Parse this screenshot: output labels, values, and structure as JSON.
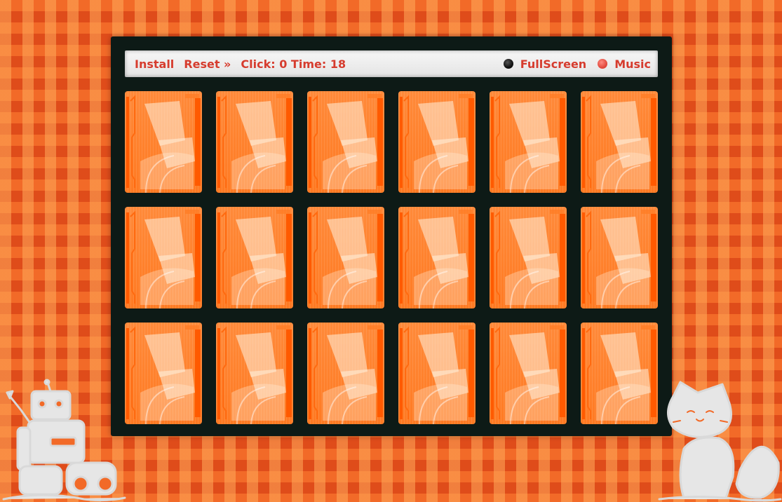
{
  "toolbar": {
    "install_label": "Install",
    "reset_label": "Reset »",
    "click_label": "Click:",
    "click_count": "0",
    "time_label": "Time:",
    "time_value": "18",
    "fullscreen_label": "FullScreen",
    "music_label": "Music"
  },
  "board": {
    "rows": 3,
    "columns": 6,
    "cards": [
      {
        "state": "face-down"
      },
      {
        "state": "face-down"
      },
      {
        "state": "face-down"
      },
      {
        "state": "face-down"
      },
      {
        "state": "face-down"
      },
      {
        "state": "face-down"
      },
      {
        "state": "face-down"
      },
      {
        "state": "face-down"
      },
      {
        "state": "face-down"
      },
      {
        "state": "face-down"
      },
      {
        "state": "face-down"
      },
      {
        "state": "face-down"
      },
      {
        "state": "face-down"
      },
      {
        "state": "face-down"
      },
      {
        "state": "face-down"
      },
      {
        "state": "face-down"
      },
      {
        "state": "face-down"
      },
      {
        "state": "face-down"
      }
    ]
  },
  "colors": {
    "accent": "#d63c2e",
    "card": "#ff7a22",
    "board": "#0d1a16",
    "fullscreen_indicator": "#111111",
    "music_indicator": "#e0463a"
  },
  "decorations": {
    "left": "robot-sketch",
    "right": "fox-sketch"
  }
}
